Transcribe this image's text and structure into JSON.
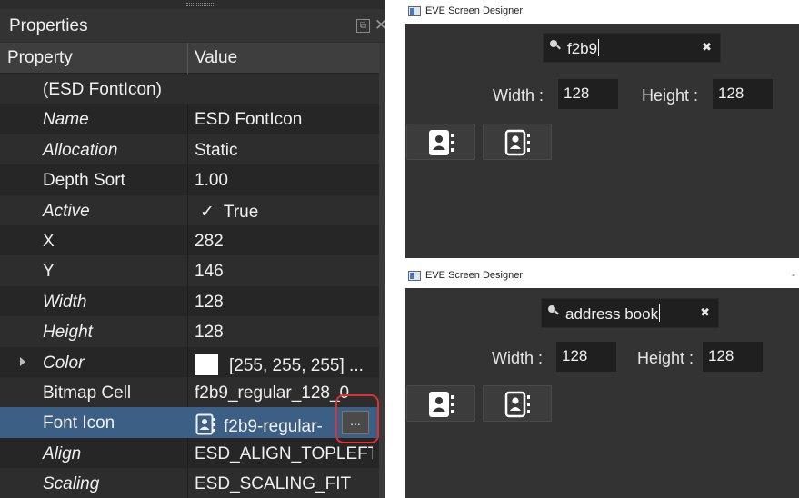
{
  "properties_panel": {
    "title": "Properties",
    "columns": {
      "property": "Property",
      "value": "Value"
    },
    "rows": [
      {
        "name": "(ESD FontIcon)",
        "value": "",
        "italic": false
      },
      {
        "name": "Name",
        "value": "ESD FontIcon",
        "italic": true
      },
      {
        "name": "Allocation",
        "value": "Static",
        "italic": true
      },
      {
        "name": "Depth Sort",
        "value": "1.00",
        "italic": false
      },
      {
        "name": "Active",
        "value": "True",
        "italic": true
      },
      {
        "name": "X",
        "value": "282",
        "italic": false
      },
      {
        "name": "Y",
        "value": "146",
        "italic": false
      },
      {
        "name": "Width",
        "value": "128",
        "italic": true
      },
      {
        "name": "Height",
        "value": "128",
        "italic": true
      },
      {
        "name": "Color",
        "value": "[255, 255, 255] ...",
        "italic": true
      },
      {
        "name": "Bitmap Cell",
        "value": "f2b9_regular_128_0",
        "italic": false
      },
      {
        "name": "Font Icon",
        "value": "f2b9-regular-",
        "italic": false
      },
      {
        "name": "Align",
        "value": "ESD_ALIGN_TOPLEFT",
        "italic": true
      },
      {
        "name": "Scaling",
        "value": "ESD_SCALING_FIT",
        "italic": true
      }
    ],
    "ellipsis_label": "...",
    "colors": {
      "selected_row": "#3c5f86",
      "highlight": "#e0302e",
      "swatch": "#ffffff"
    }
  },
  "designer_top": {
    "window_title": "EVE Screen Designer",
    "search_value": "f2b9",
    "width_label": "Width :",
    "width_value": "128",
    "height_label": "Height :",
    "height_value": "128",
    "icons": [
      "address-book-solid-icon",
      "address-book-regular-icon"
    ]
  },
  "designer_bottom": {
    "window_title": "EVE Screen Designer",
    "search_value": "address book",
    "width_label": "Width :",
    "width_value": "128",
    "height_label": "Height :",
    "height_value": "128",
    "icons": [
      "address-book-solid-icon",
      "address-book-regular-icon"
    ]
  }
}
